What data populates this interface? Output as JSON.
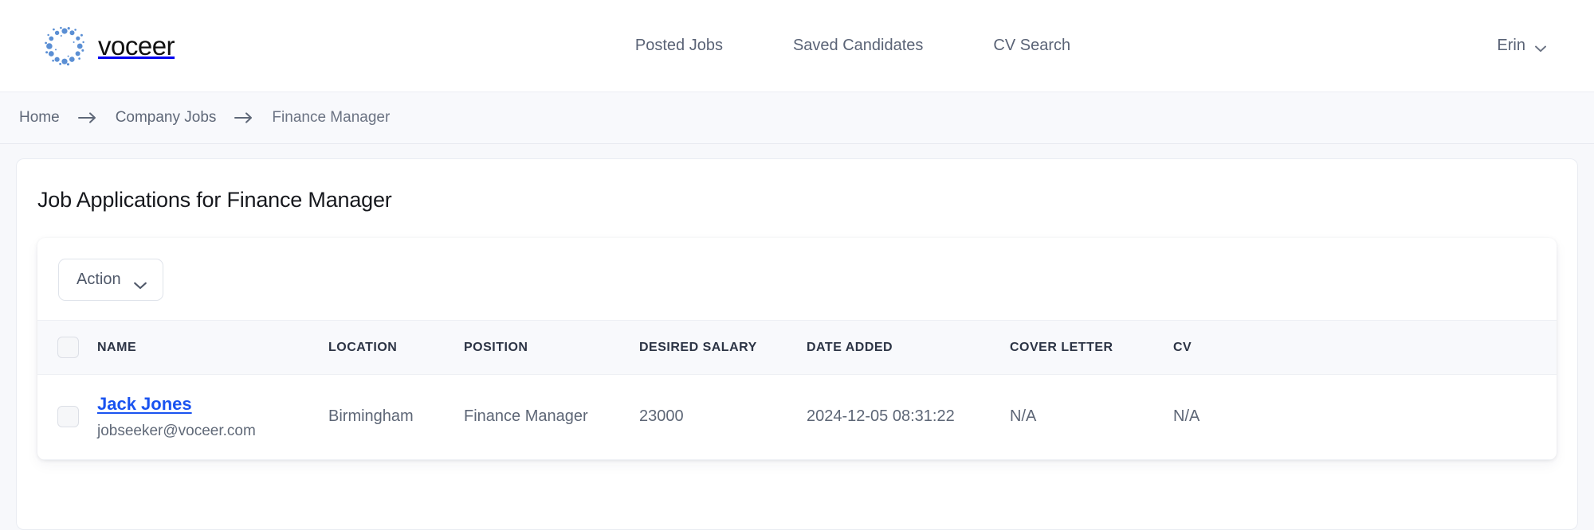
{
  "header": {
    "logo_icon": "voceer-dots-logo-icon",
    "brand": "voceer",
    "nav": [
      {
        "label": "Posted Jobs"
      },
      {
        "label": "Saved Candidates"
      },
      {
        "label": "CV Search"
      }
    ],
    "user": {
      "name": "Erin",
      "chevron_icon": "chevron-down-icon"
    }
  },
  "breadcrumb": {
    "separator_icon": "arrow-right-icon",
    "items": [
      {
        "label": "Home"
      },
      {
        "label": "Company Jobs"
      },
      {
        "label": "Finance Manager"
      }
    ]
  },
  "main": {
    "title": "Job Applications for Finance Manager",
    "toolbar": {
      "action_label": "Action",
      "action_chevron_icon": "chevron-down-icon"
    },
    "table": {
      "select_all_name": "select-all-checkbox",
      "columns": [
        "NAME",
        "LOCATION",
        "POSITION",
        "DESIRED SALARY",
        "DATE ADDED",
        "COVER LETTER",
        "CV"
      ],
      "rows": [
        {
          "name": "Jack Jones",
          "email": "jobseeker@voceer.com",
          "location": "Birmingham",
          "position": "Finance Manager",
          "desired_salary": "23000",
          "date_added": "2024-12-05 08:31:22",
          "cover_letter": "N/A",
          "cv": "N/A"
        }
      ]
    }
  },
  "colors": {
    "link_blue": "#1a53f0",
    "logo_blue": "#5b8fd4",
    "text_muted": "#5d6676",
    "page_bg": "#f7f8fb"
  }
}
